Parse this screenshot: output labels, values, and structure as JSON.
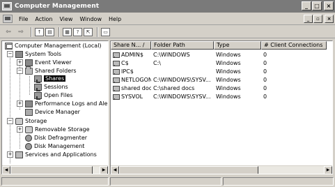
{
  "window": {
    "title": "Computer Management",
    "buttons": {
      "minimize": "_",
      "maximize": "□",
      "close": "×"
    },
    "mdi_buttons": {
      "minimize": "_",
      "restore": "▫",
      "close": "×"
    }
  },
  "menu": [
    {
      "label": "File"
    },
    {
      "label": "Action"
    },
    {
      "label": "View"
    },
    {
      "label": "Window"
    },
    {
      "label": "Help"
    }
  ],
  "toolbar": {
    "back_icon": "⇦",
    "forward_icon": "⇨",
    "up_icon": "↑",
    "show_hide_icon": "▤",
    "properties_icon": "▦",
    "help_icon": "?",
    "export_icon": "⇱",
    "connect_icon": "▭"
  },
  "tree": {
    "root": "Computer Management (Local)",
    "system_tools": "System Tools",
    "event_viewer": "Event Viewer",
    "shared_folders": "Shared Folders",
    "shares": "Shares",
    "sessions": "Sessions",
    "open_files": "Open Files",
    "performance": "Performance Logs and Alerts",
    "device_manager": "Device Manager",
    "storage": "Storage",
    "removable_storage": "Removable Storage",
    "disk_defragmenter": "Disk Defragmenter",
    "disk_management": "Disk Management",
    "services": "Services and Applications"
  },
  "list": {
    "columns": [
      "Share N... /",
      "Folder Path",
      "Type",
      "# Client Connections"
    ],
    "rows": [
      {
        "name": "ADMIN$",
        "path": "C:\\WINDOWS",
        "type": "Windows",
        "connections": "0"
      },
      {
        "name": "C$",
        "path": "C:\\",
        "type": "Windows",
        "connections": "0"
      },
      {
        "name": "IPC$",
        "path": "",
        "type": "Windows",
        "connections": "0"
      },
      {
        "name": "NETLOGON",
        "path": "C:\\WINDOWS\\SYSV...",
        "type": "Windows",
        "connections": "0"
      },
      {
        "name": "shared docs",
        "path": "C:\\shared docs",
        "type": "Windows",
        "connections": "0"
      },
      {
        "name": "SYSVOL",
        "path": "C:\\WINDOWS\\SYSV...",
        "type": "Windows",
        "connections": "0"
      }
    ]
  },
  "scroll": {
    "left": "◀",
    "right": "▶"
  },
  "colors": {
    "titlebar": "#7a7a7a",
    "face": "#d4d0c8",
    "selection": "#000000"
  }
}
